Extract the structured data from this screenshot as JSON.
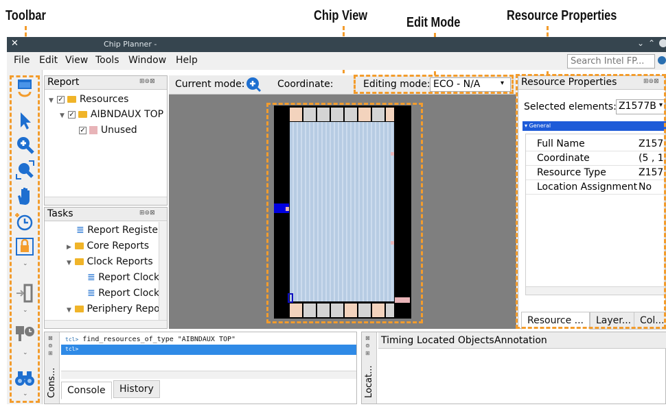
{
  "callouts": {
    "toolbar": "Toolbar",
    "chip_view": "Chip View",
    "edit_mode": "Edit Mode",
    "resource_properties": "Resource Properties"
  },
  "window": {
    "title": "Chip Planner -"
  },
  "menu": [
    "File",
    "Edit",
    "View",
    "Tools",
    "Window",
    "Help"
  ],
  "search": {
    "placeholder": "Search Intel FP..."
  },
  "report_panel": {
    "title": "Report",
    "tree": [
      {
        "label": "Resources",
        "checked": true
      },
      {
        "label": "AIBNDAUX TOP",
        "checked": true
      },
      {
        "label": "Unused",
        "checked": true
      }
    ]
  },
  "tasks_panel": {
    "title": "Tasks",
    "items": [
      {
        "label": "Report Register"
      },
      {
        "label": "Core Reports"
      },
      {
        "label": "Clock Reports"
      },
      {
        "label": "Report Clock"
      },
      {
        "label": "Report Clock"
      },
      {
        "label": "Periphery Repo"
      }
    ]
  },
  "chip_toolbar": {
    "current_mode_label": "Current mode:",
    "coordinate_label": "Coordinate:",
    "editing_mode_label": "Editing mode:",
    "editing_mode_value": "ECO - N/A"
  },
  "resource_properties": {
    "title": "Resource Properties",
    "selected_label": "Selected elements:",
    "selected_value": "Z1577B",
    "group": "General",
    "rows": [
      {
        "name": "Full Name",
        "value": "Z157"
      },
      {
        "name": "Coordinate",
        "value": "(5 , 1"
      },
      {
        "name": "Resource Type",
        "value": "Z157"
      },
      {
        "name": "Location Assignment",
        "value": "No"
      }
    ],
    "tabs": [
      "Resource ...",
      "Layer...",
      "Col..."
    ]
  },
  "console": {
    "side_label": "Cons...",
    "command": "find_resources_of_type \"AIBNDAUX TOP\"",
    "prompt": "tcl>",
    "tabs": [
      "Console",
      "History"
    ]
  },
  "located": {
    "side_label": "Locat...",
    "tabs": [
      "Timing",
      "Located Objects",
      "Annotation"
    ]
  },
  "toolbar_icons": [
    "window-refresh-icon",
    "pointer-icon",
    "zoom-in-icon",
    "zoom-fit-icon",
    "hand-pan-icon",
    "timer-icon",
    "lock-icon",
    "cell-insert-icon",
    "route-timer-icon",
    "binoculars-icon"
  ],
  "colors": {
    "callout_dash": "#f39c2c",
    "title_bar": "#36454f",
    "chip_bg": "#7f7f7f",
    "selection_blue": "#2f8ae6",
    "unused_swatch": "#e8b4b8"
  }
}
